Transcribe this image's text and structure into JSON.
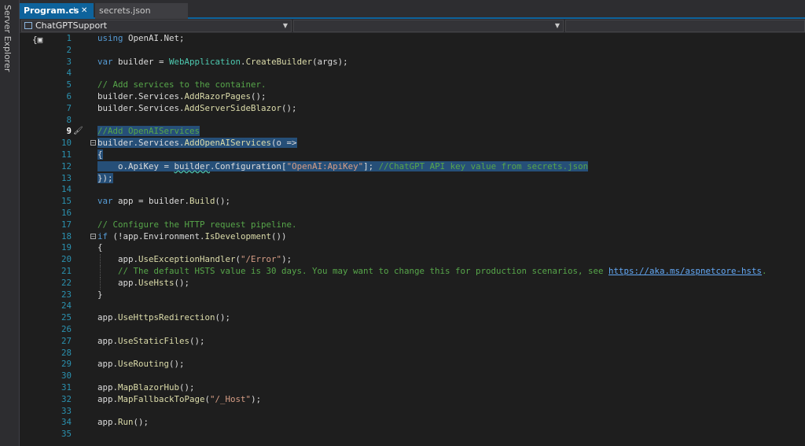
{
  "side_panel": {
    "label": "Server Explorer"
  },
  "tabs": [
    {
      "label": "Program.cs",
      "active": true,
      "pin_icon": "pin-icon",
      "close_icon": "close-icon"
    },
    {
      "label": "secrets.json",
      "active": false
    }
  ],
  "navigation": {
    "project_combo": "ChatGPTSupport",
    "member_combo": "",
    "third_combo": ""
  },
  "editor": {
    "current_line": 9,
    "lines": [
      {
        "n": "1",
        "tokens": [
          [
            "kw",
            "using"
          ],
          [
            "t",
            " OpenAI.Net;"
          ]
        ]
      },
      {
        "n": "2",
        "tokens": []
      },
      {
        "n": "3",
        "tokens": [
          [
            "kw",
            "var"
          ],
          [
            "t",
            " builder = "
          ],
          [
            "type",
            "WebApplication"
          ],
          [
            "t",
            "."
          ],
          [
            "method",
            "CreateBuilder"
          ],
          [
            "t",
            "(args);"
          ]
        ]
      },
      {
        "n": "4",
        "tokens": []
      },
      {
        "n": "5",
        "tokens": [
          [
            "cmt",
            "// Add services to the container."
          ]
        ]
      },
      {
        "n": "6",
        "tokens": [
          [
            "t",
            "builder.Services."
          ],
          [
            "method",
            "AddRazorPages"
          ],
          [
            "t",
            "();"
          ]
        ]
      },
      {
        "n": "7",
        "tokens": [
          [
            "t",
            "builder.Services."
          ],
          [
            "method",
            "AddServerSideBlazor"
          ],
          [
            "t",
            "();"
          ]
        ]
      },
      {
        "n": "8",
        "tokens": []
      },
      {
        "n": "9",
        "tokens": [
          [
            "cmt",
            "//Add OpenAIServices"
          ]
        ],
        "selected": true
      },
      {
        "n": "10",
        "tokens": [
          [
            "t",
            "builder.Services."
          ],
          [
            "method",
            "AddOpenAIServices"
          ],
          [
            "t",
            "(o =>"
          ]
        ],
        "selected": true,
        "fold": true
      },
      {
        "n": "11",
        "tokens": [
          [
            "t",
            "{"
          ]
        ],
        "selected": true
      },
      {
        "n": "12",
        "tokens": [
          [
            "t",
            "    o.ApiKey = "
          ],
          [
            "sq",
            "builder"
          ],
          [
            "t",
            "."
          ],
          [
            "t",
            "Configuration["
          ],
          [
            "str",
            "\"OpenAI:ApiKey\""
          ],
          [
            "t",
            "]; "
          ],
          [
            "cmt",
            "//ChatGPT API key value from secrets.json"
          ]
        ],
        "selected": true
      },
      {
        "n": "13",
        "tokens": [
          [
            "t",
            "});"
          ]
        ],
        "selected": true
      },
      {
        "n": "14",
        "tokens": []
      },
      {
        "n": "15",
        "tokens": [
          [
            "kw",
            "var"
          ],
          [
            "t",
            " app = builder."
          ],
          [
            "method",
            "Build"
          ],
          [
            "t",
            "();"
          ]
        ]
      },
      {
        "n": "16",
        "tokens": []
      },
      {
        "n": "17",
        "tokens": [
          [
            "cmt",
            "// Configure the HTTP request pipeline."
          ]
        ]
      },
      {
        "n": "18",
        "tokens": [
          [
            "kw",
            "if"
          ],
          [
            "t",
            " (!app.Environment."
          ],
          [
            "method",
            "IsDevelopment"
          ],
          [
            "t",
            "())"
          ]
        ],
        "fold": true
      },
      {
        "n": "19",
        "tokens": [
          [
            "t",
            "{"
          ]
        ]
      },
      {
        "n": "20",
        "tokens": [
          [
            "t",
            "    app."
          ],
          [
            "method",
            "UseExceptionHandler"
          ],
          [
            "t",
            "("
          ],
          [
            "str",
            "\"/Error\""
          ],
          [
            "t",
            ");"
          ]
        ],
        "guide": true
      },
      {
        "n": "21",
        "tokens": [
          [
            "cmt",
            "    // The default HSTS value is 30 days. You may want to change this for production scenarios, see "
          ],
          [
            "link",
            "https://aka.ms/aspnetcore-hsts"
          ],
          [
            "cmt",
            "."
          ]
        ],
        "guide": true
      },
      {
        "n": "22",
        "tokens": [
          [
            "t",
            "    app."
          ],
          [
            "method",
            "UseHsts"
          ],
          [
            "t",
            "();"
          ]
        ],
        "guide": true
      },
      {
        "n": "23",
        "tokens": [
          [
            "t",
            "}"
          ]
        ]
      },
      {
        "n": "24",
        "tokens": []
      },
      {
        "n": "25",
        "tokens": [
          [
            "t",
            "app."
          ],
          [
            "method",
            "UseHttpsRedirection"
          ],
          [
            "t",
            "();"
          ]
        ]
      },
      {
        "n": "26",
        "tokens": []
      },
      {
        "n": "27",
        "tokens": [
          [
            "t",
            "app."
          ],
          [
            "method",
            "UseStaticFiles"
          ],
          [
            "t",
            "();"
          ]
        ]
      },
      {
        "n": "28",
        "tokens": []
      },
      {
        "n": "29",
        "tokens": [
          [
            "t",
            "app."
          ],
          [
            "method",
            "UseRouting"
          ],
          [
            "t",
            "();"
          ]
        ]
      },
      {
        "n": "30",
        "tokens": []
      },
      {
        "n": "31",
        "tokens": [
          [
            "t",
            "app."
          ],
          [
            "method",
            "MapBlazorHub"
          ],
          [
            "t",
            "();"
          ]
        ]
      },
      {
        "n": "32",
        "tokens": [
          [
            "t",
            "app."
          ],
          [
            "method",
            "MapFallbackToPage"
          ],
          [
            "t",
            "("
          ],
          [
            "str",
            "\"/_Host\""
          ],
          [
            "t",
            ");"
          ]
        ]
      },
      {
        "n": "33",
        "tokens": []
      },
      {
        "n": "34",
        "tokens": [
          [
            "t",
            "app."
          ],
          [
            "method",
            "Run"
          ],
          [
            "t",
            "();"
          ]
        ]
      },
      {
        "n": "35",
        "tokens": []
      }
    ]
  },
  "colors": {
    "accent_tab": "#0e639c",
    "editor_bg": "#1e1e1e",
    "selection": "#264f78",
    "keyword": "#569cd6",
    "type": "#4ec9b0",
    "method": "#dcdcaa",
    "string": "#d69d85",
    "comment": "#57a64a",
    "line_number": "#2b91af"
  }
}
